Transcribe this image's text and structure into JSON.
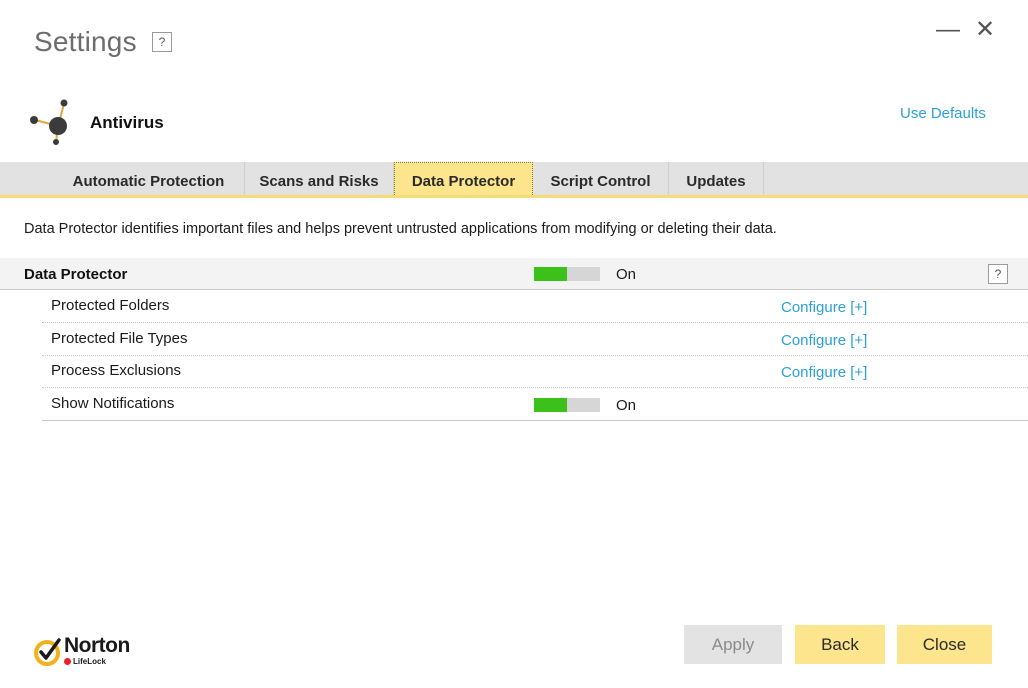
{
  "window": {
    "title": "Settings",
    "help_label": "?",
    "minimize_label": "—",
    "close_label": "✕"
  },
  "product": {
    "name": "Antivirus",
    "icon": "antivirus-molecule-icon",
    "use_defaults_label": "Use Defaults"
  },
  "tabs": [
    {
      "label": "Automatic Protection",
      "active": false
    },
    {
      "label": "Scans and Risks",
      "active": false
    },
    {
      "label": "Data Protector",
      "active": true
    },
    {
      "label": "Script Control",
      "active": false
    },
    {
      "label": "Updates",
      "active": false
    }
  ],
  "description": "Data Protector identifies important files and helps prevent untrusted applications from modifying or deleting their data.",
  "section": {
    "title": "Data Protector",
    "toggle_label": "On",
    "toggle_on": true,
    "help_label": "?"
  },
  "rows": [
    {
      "label": "Protected Folders",
      "action": "Configure [+]"
    },
    {
      "label": "Protected File Types",
      "action": "Configure [+]"
    },
    {
      "label": "Process Exclusions",
      "action": "Configure [+]"
    },
    {
      "label": "Show Notifications",
      "toggle_label": "On",
      "toggle_on": true
    }
  ],
  "footer": {
    "logo_word": "Norton",
    "logo_sub": "LifeLock",
    "apply_label": "Apply",
    "back_label": "Back",
    "close_label": "Close"
  },
  "colors": {
    "accent_yellow": "#fce58c",
    "toggle_on": "#3cc11b",
    "link_blue": "#2b9fd9",
    "logo_red": "#e8212b"
  }
}
